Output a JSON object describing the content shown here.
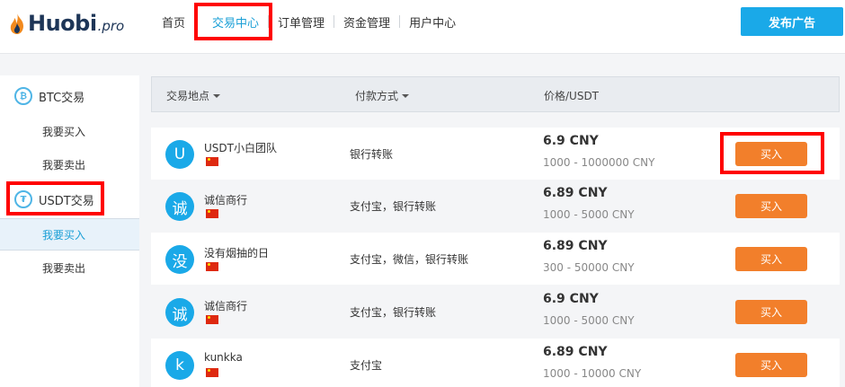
{
  "header": {
    "logo_text": "Huobi",
    "logo_suffix": ".pro",
    "nav": [
      {
        "label": "首页"
      },
      {
        "label": "交易中心"
      },
      {
        "label": "订单管理"
      },
      {
        "label": "资金管理"
      },
      {
        "label": "用户中心"
      }
    ],
    "publish_label": "发布广告"
  },
  "sidebar": {
    "btc_group": {
      "label": "BTC交易",
      "icon": "bitcoin-icon"
    },
    "btc_items": [
      {
        "label": "我要买入"
      },
      {
        "label": "我要卖出"
      }
    ],
    "usdt_group": {
      "label": "USDT交易",
      "icon": "tether-icon"
    },
    "usdt_items": [
      {
        "label": "我要买入"
      },
      {
        "label": "我要卖出"
      }
    ]
  },
  "table": {
    "headers": {
      "location": "交易地点",
      "payment": "付款方式",
      "price": "价格/USDT"
    },
    "rows": [
      {
        "avatar": "U",
        "name": "USDT小白团队",
        "payment": "银行转账",
        "price": "6.9 CNY",
        "limit": "1000 - 1000000 CNY",
        "button": "买入"
      },
      {
        "avatar": "诚",
        "name": "诚信商行",
        "payment": "支付宝，银行转账",
        "price": "6.89 CNY",
        "limit": "1000 - 5000 CNY",
        "button": "买入"
      },
      {
        "avatar": "没",
        "name": "没有烟抽的日",
        "payment": "支付宝，微信，银行转账",
        "price": "6.89 CNY",
        "limit": "300 - 50000 CNY",
        "button": "买入"
      },
      {
        "avatar": "诚",
        "name": "诚信商行",
        "payment": "支付宝，银行转账",
        "price": "6.9 CNY",
        "limit": "1000 - 5000 CNY",
        "button": "买入"
      },
      {
        "avatar": "k",
        "name": "kunkka",
        "payment": "支付宝",
        "price": "6.89 CNY",
        "limit": "1000 - 10000 CNY",
        "button": "买入"
      }
    ]
  },
  "colors": {
    "accent": "#1aa9e8",
    "buy_button": "#f27f2b",
    "highlight": "#ff0000"
  }
}
